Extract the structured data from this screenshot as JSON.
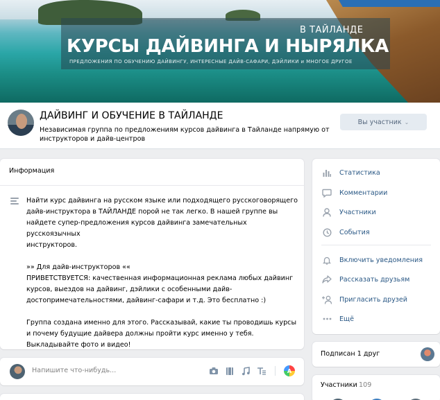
{
  "cover": {
    "subtitle_top": "В ТАЙЛАНДЕ",
    "title": "КУРСЫ ДАЙВИНГА И НЫРЯЛКА",
    "subtitle_bottom": "ПРЕДЛОЖЕНИЯ ПО ОБУЧЕНИЮ ДАЙВИНГУ, ИНТЕРЕСНЫЕ ДАЙВ-САФАРИ, ДЭЙЛИКИ и МНОГОЕ ДРУГОЕ"
  },
  "header": {
    "group_name": "ДАЙВИНГ И ОБУЧЕНИЕ В ТАЙЛАНДЕ",
    "description": "Независимая группа по предложениям курсов дайвинга в Тайланде напрямую от инструкторов и дайв-центров",
    "member_button": "Вы участник",
    "member_chevron": "⌄"
  },
  "info": {
    "title": "Информация",
    "paragraphs": [
      [
        "Найти курс дайвинга на русском языке или подходящего русскоговорящего",
        "дайв-инструктора в ТАЙЛАНДЕ порой не так легко. В нашей группе вы",
        "найдете супер-предложения курсов дайвинга замечательных русскоязычных",
        "инструкторов."
      ],
      [
        "»» Для дайв-инструкторов ««",
        "ПРИВЕТСТВУЕТСЯ: качественная информационная реклама любых дайвинг",
        "курсов, выездов на дайвинг, дэйлики с особенными дайв-",
        "достопримечательностями, дайвинг-сафари и т.д. Это бесплатно :)"
      ],
      [
        "Группа создана именно для этого. Рассказывай, какие ты проводишь курсы",
        "и почему будущие дайвера должны пройти курс именно у тебя.",
        "Выкладывайте фото и видео!"
      ]
    ]
  },
  "post": {
    "placeholder": "Напишите что-нибудь...",
    "tool_a": "A"
  },
  "menu": {
    "items": [
      {
        "label": "Статистика",
        "icon": "stats-icon",
        "glyph": "▮"
      },
      {
        "label": "Комментарии",
        "icon": "comment-icon",
        "glyph": "💬"
      },
      {
        "label": "Участники",
        "icon": "user-icon",
        "glyph": "👤"
      },
      {
        "label": "События",
        "icon": "calendar-icon",
        "glyph": "◷"
      },
      {
        "label": "Включить уведомления",
        "icon": "bell-icon",
        "glyph": "🔔"
      },
      {
        "label": "Рассказать друзьям",
        "icon": "share-icon",
        "glyph": "↪"
      },
      {
        "label": "Пригласить друзей",
        "icon": "invite-icon",
        "glyph": "+"
      },
      {
        "label": "Ещё",
        "icon": "more-icon",
        "glyph": "•••"
      }
    ]
  },
  "friends": {
    "label": "Подписан 1 друг"
  },
  "members": {
    "label": "Участники",
    "count": "109"
  }
}
